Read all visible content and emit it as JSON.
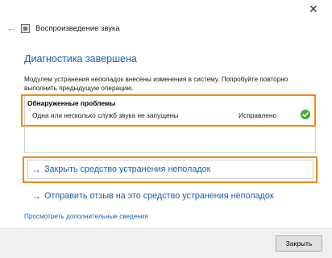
{
  "window": {
    "title": "Воспроизведение звука",
    "back_icon": "back-arrow-icon",
    "close_glyph": "✕"
  },
  "main": {
    "heading": "Диагностика завершена",
    "description": "Модулем устранения неполадок внесены изменения в систему. Попробуйте повторно выполнить предыдущую операцию."
  },
  "problems": {
    "header": "Обнаруженные проблемы",
    "items": [
      {
        "text": "Одна или несколько служб звука не запущены",
        "status": "Исправлено",
        "status_icon": "check-circle-icon"
      }
    ]
  },
  "actions": {
    "arrow_glyph": "→",
    "close_troubleshooter": "Закрыть средство устранения неполадок",
    "send_feedback": "Отправить отзыв на это средство устранения неполадок"
  },
  "links": {
    "more_info": "Просмотреть дополнительные сведения"
  },
  "footer": {
    "close_button": "Закрыть"
  },
  "colors": {
    "link_blue": "#1a5fa8",
    "highlight_orange": "#ef8a13",
    "status_green": "#4aa832"
  }
}
